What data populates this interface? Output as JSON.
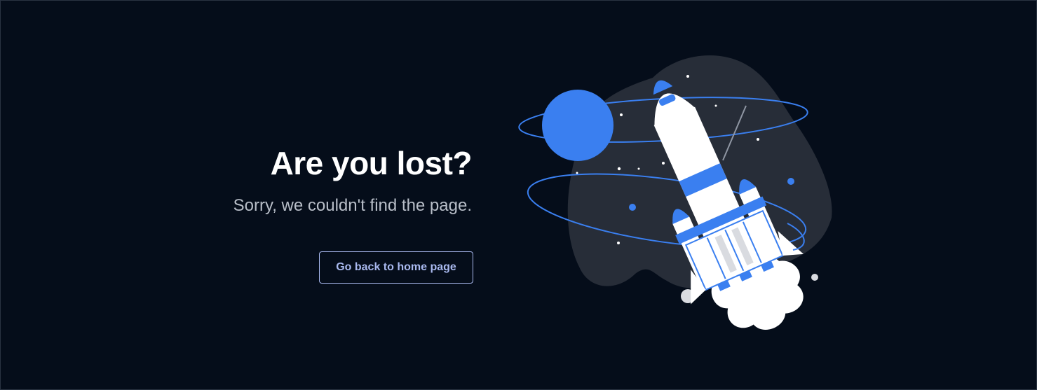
{
  "error": {
    "title": "Are you lost?",
    "message": "Sorry, we couldn't find the page."
  },
  "actions": {
    "home_button_label": "Go back to home page"
  },
  "illustration": {
    "subject": "rocket-launch-illustration"
  },
  "colors": {
    "background": "#050d1a",
    "blob": "#272d38",
    "accent_blue": "#3a7ff0",
    "button_text": "#a9b9ef",
    "rocket_white": "#ffffff"
  }
}
